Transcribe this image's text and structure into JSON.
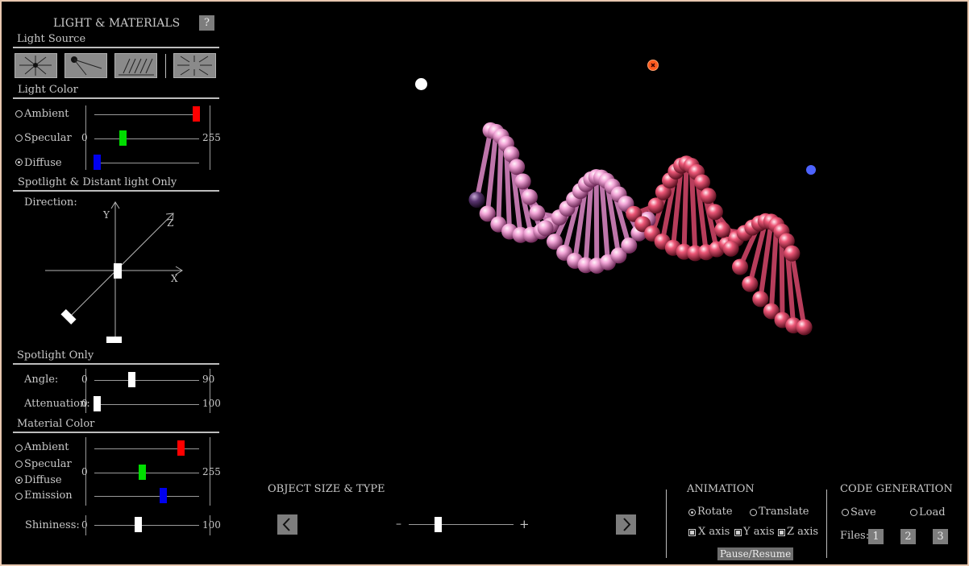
{
  "panel": {
    "title": "LIGHT & MATERIALS",
    "help_label": "?",
    "light_source": {
      "heading": "Light Source",
      "buttons": [
        "point-light",
        "spotlight",
        "distant-light",
        "inward-light"
      ]
    },
    "light_color": {
      "heading": "Light Color",
      "options": [
        "Ambient",
        "Specular",
        "Diffuse"
      ],
      "selected": "Diffuse",
      "min": "0",
      "max": "255",
      "slider_values": {
        "red": 0.97,
        "green": 0.27,
        "blue": 0.03
      }
    },
    "direction": {
      "heading": "Spotlight & Distant light Only",
      "label": "Direction:",
      "axis_y": "Y",
      "axis_z": "Z",
      "axis_x": "X"
    },
    "spotlight": {
      "heading": "Spotlight Only",
      "angle_label": "Angle:",
      "angle_min": "0",
      "angle_max": "90",
      "angle_value": 0.36,
      "atten_label": "Attenuation:",
      "atten_min": "0",
      "atten_max": "100",
      "atten_value": 0.03
    },
    "material": {
      "heading": "Material Color",
      "options": [
        "Ambient",
        "Specular",
        "Diffuse",
        "Emission"
      ],
      "selected": "Diffuse",
      "min": "0",
      "max": "255",
      "slider_values": {
        "red": 0.83,
        "green": 0.46,
        "blue": 0.66
      },
      "shininess_label": "Shininess:",
      "shininess_min": "0",
      "shininess_max": "100",
      "shininess_value": 0.42
    }
  },
  "object": {
    "heading": "OBJECT SIZE & TYPE",
    "minus": "–",
    "plus": "+",
    "size_value": 0.28
  },
  "animation": {
    "heading": "ANIMATION",
    "rotate_label": "Rotate",
    "translate_label": "Translate",
    "mode": "Rotate",
    "x_axis": "X axis",
    "y_axis": "Y axis",
    "z_axis": "Z axis",
    "pause_label": "Pause/Resume"
  },
  "code_generation": {
    "heading": "CODE GENERATION",
    "save_label": "Save",
    "load_label": "Load",
    "files_label": "Files:",
    "files": [
      "1",
      "2",
      "3"
    ]
  },
  "colors": {
    "slider_red": "#ff0000",
    "slider_green": "#00dd00",
    "slider_blue": "#0000ee",
    "light_marker": "#ffffff",
    "target_marker": "#ff5a1e",
    "blue_marker": "#4d63ff"
  }
}
